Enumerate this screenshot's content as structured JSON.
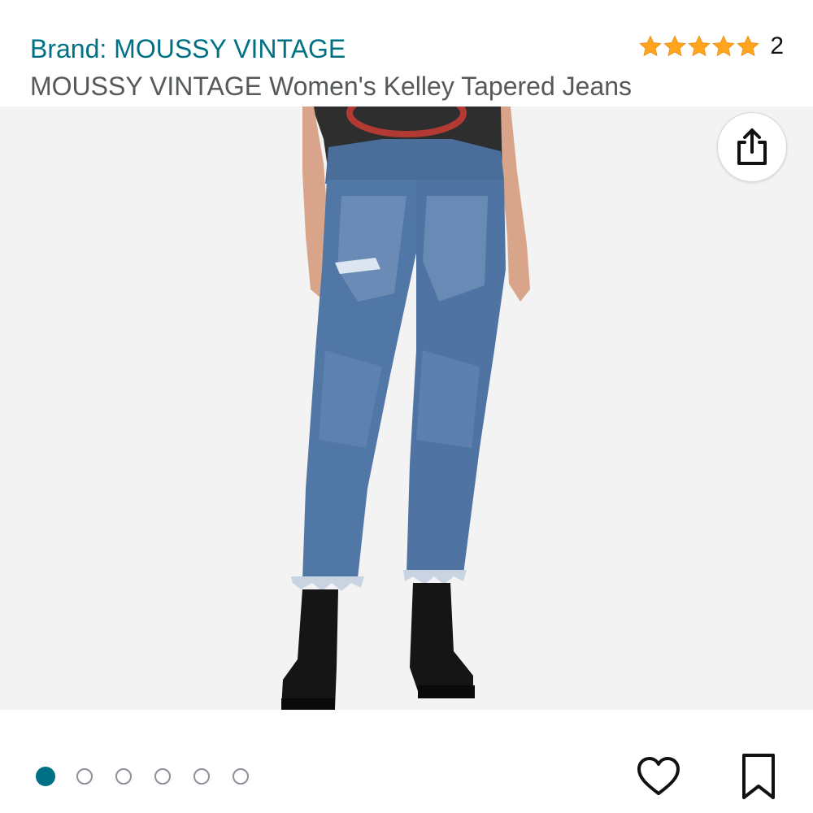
{
  "header": {
    "brand_link": "Brand: MOUSSY VINTAGE",
    "title": "MOUSSY VINTAGE Women's Kelley Tapered Jeans",
    "rating": {
      "stars": 5,
      "count": "2"
    }
  },
  "image": {
    "alt": "Model wearing distressed blue tapered jeans with frayed hems, black t-shirt and black lace-up boots"
  },
  "carousel": {
    "total_images": 6,
    "active_index": 0
  },
  "icons": {
    "share": "share-icon",
    "heart": "heart-icon",
    "save": "bookmark-icon",
    "star": "star-icon"
  },
  "colors": {
    "link": "#007185",
    "title": "#565959",
    "star": "#FFA41C",
    "image_bg": "#f3f3f3"
  }
}
